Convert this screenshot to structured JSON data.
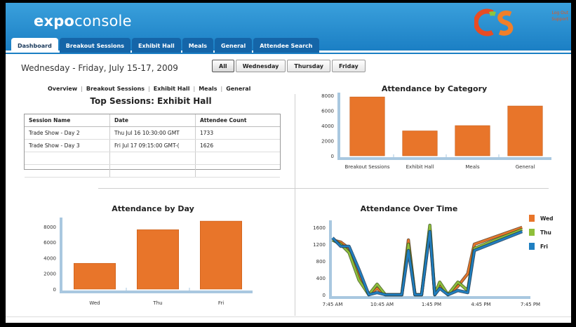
{
  "app": {
    "title_bold": "expo",
    "title_rest": "console"
  },
  "header_links": [
    "Log Out",
    "Support"
  ],
  "tabs": [
    {
      "label": "Dashboard",
      "active": true
    },
    {
      "label": "Breakout Sessions"
    },
    {
      "label": "Exhibit Hall"
    },
    {
      "label": "Meals"
    },
    {
      "label": "General"
    },
    {
      "label": "Attendee Search"
    }
  ],
  "date_range": "Wednesday - Friday, July 15-17, 2009",
  "day_filter": [
    {
      "label": "All",
      "active": true
    },
    {
      "label": "Wednesday"
    },
    {
      "label": "Thursday"
    },
    {
      "label": "Friday"
    }
  ],
  "subnav": [
    "Overview",
    "Breakout Sessions",
    "Exhibit Hall",
    "Meals",
    "General"
  ],
  "top_sessions": {
    "title": "Top Sessions: Exhibit Hall",
    "columns": [
      "Session Name",
      "Date",
      "Attendee Count"
    ],
    "rows": [
      [
        "Trade Show - Day 2",
        "Thu Jul 16 10:30:00 GMT",
        "1733"
      ],
      [
        "Trade Show - Day 3",
        "Fri Jul 17 09:15:00 GMT-(",
        "1626"
      ]
    ]
  },
  "colors": {
    "orange": "#e8752a",
    "green": "#8fbf3a",
    "blue": "#1f7fc1",
    "axis": "#a9c8e0"
  },
  "chart_data": [
    {
      "type": "bar",
      "title": "Attendance by Category",
      "categories": [
        "Breakout Sessions",
        "Exhibit Hall",
        "Meals",
        "General"
      ],
      "values": [
        7800,
        3300,
        4000,
        6600
      ],
      "ylim": [
        0,
        8000
      ],
      "yticks": [
        0,
        2000,
        4000,
        6000,
        8000
      ]
    },
    {
      "type": "bar",
      "title": "Attendance by Day",
      "categories": [
        "Wed",
        "Thu",
        "Fri"
      ],
      "values": [
        3300,
        7600,
        8700
      ],
      "ylim": [
        0,
        8800
      ],
      "yticks": [
        0,
        2000,
        4000,
        6000,
        8000
      ]
    },
    {
      "type": "line",
      "title": "Attendance Over Time",
      "xticks": [
        "7:45 AM",
        "10:45 AM",
        "1:45 PM",
        "4:45 PM",
        "7:45 PM"
      ],
      "xlim": [
        0,
        12
      ],
      "ylim": [
        0,
        1700
      ],
      "yticks": [
        0,
        400,
        800,
        1200,
        1600
      ],
      "legend_position": "right",
      "series": [
        {
          "name": "Wed",
          "x": [
            0,
            0.5,
            1.0,
            1.6,
            2.2,
            2.7,
            3.2,
            3.6,
            4.2,
            4.6,
            5.0,
            5.4,
            5.9,
            6.2,
            6.5,
            7.0,
            7.6,
            8.2,
            8.6,
            11.5
          ],
          "y": [
            1300,
            1250,
            1100,
            450,
            0,
            150,
            0,
            0,
            0,
            1300,
            0,
            0,
            1550,
            0,
            200,
            0,
            200,
            500,
            1200,
            1600
          ]
        },
        {
          "name": "Thu",
          "x": [
            0,
            0.5,
            1.0,
            1.6,
            2.2,
            2.7,
            3.2,
            3.6,
            4.2,
            4.6,
            5.0,
            5.4,
            5.9,
            6.2,
            6.5,
            7.0,
            7.6,
            8.2,
            8.6,
            11.5
          ],
          "y": [
            1300,
            1200,
            1000,
            350,
            0,
            250,
            0,
            0,
            0,
            1200,
            0,
            0,
            1650,
            0,
            300,
            0,
            300,
            100,
            1100,
            1550
          ]
        },
        {
          "name": "Fri",
          "x": [
            0,
            0.5,
            1.0,
            1.6,
            2.2,
            2.7,
            3.2,
            3.6,
            4.2,
            4.6,
            5.0,
            5.4,
            5.9,
            6.2,
            6.5,
            7.0,
            7.6,
            8.2,
            8.6,
            11.5
          ],
          "y": [
            1350,
            1150,
            1150,
            600,
            0,
            50,
            0,
            0,
            0,
            1050,
            0,
            0,
            1500,
            0,
            150,
            0,
            100,
            50,
            1050,
            1500
          ]
        }
      ]
    }
  ]
}
